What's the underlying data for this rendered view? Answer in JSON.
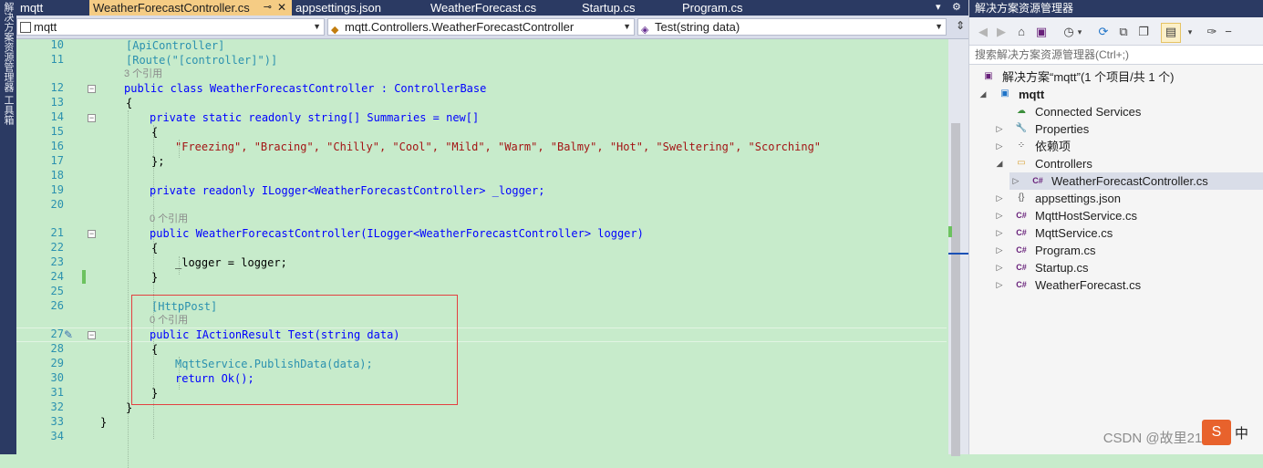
{
  "left_strip": {
    "items": [
      "解决方案资源管理器",
      "工具箱"
    ]
  },
  "tabs": [
    {
      "label": "mqtt",
      "active": false
    },
    {
      "label": "WeatherForecastController.cs",
      "active": true,
      "pin": "⊸",
      "close": "✕"
    },
    {
      "label": "appsettings.json",
      "active": false
    },
    {
      "label": "WeatherForecast.cs",
      "active": false
    },
    {
      "label": "Startup.cs",
      "active": false
    },
    {
      "label": "Program.cs",
      "active": false
    }
  ],
  "tabbar_controls": {
    "dropdown": "▾",
    "settings": "⚙"
  },
  "navbar": {
    "project": "mqtt",
    "type": "mqtt.Controllers.WeatherForecastController",
    "member": "Test(string data)"
  },
  "editor": {
    "codelens": {
      "refs3": "3 个引用",
      "refs0": "0 个引用"
    },
    "lines": {
      "10": "[ApiController]",
      "11": "[Route(\"[controller]\")]",
      "12": "public class WeatherForecastController : ControllerBase",
      "13": "{",
      "14": "private static readonly string[] Summaries = new[]",
      "15": "{",
      "16": "\"Freezing\", \"Bracing\", \"Chilly\", \"Cool\", \"Mild\", \"Warm\", \"Balmy\", \"Hot\", \"Sweltering\", \"Scorching\"",
      "17": "};",
      "18": "",
      "19": "private readonly ILogger<WeatherForecastController> _logger;",
      "20": "",
      "21": "public WeatherForecastController(ILogger<WeatherForecastController> logger)",
      "22": "{",
      "23": "_logger = logger;",
      "24": "}",
      "25": "",
      "26": "[HttpPost]",
      "27": "public IActionResult Test(string data)",
      "28": "{",
      "29": "MqttService.PublishData(data);",
      "30": "return Ok();",
      "31": "}",
      "32": "}",
      "33": "}",
      "34": ""
    },
    "line_numbers": [
      "10",
      "11",
      "12",
      "13",
      "14",
      "15",
      "16",
      "17",
      "18",
      "19",
      "20",
      "21",
      "22",
      "23",
      "24",
      "25",
      "26",
      "27",
      "28",
      "29",
      "30",
      "31",
      "32",
      "33",
      "34"
    ]
  },
  "solution_explorer": {
    "title": "解决方案资源管理器",
    "search_placeholder": "搜索解决方案资源管理器(Ctrl+;)",
    "tree": {
      "solution": "解决方案“mqtt”(1 个项目/共 1 个)",
      "project": "mqtt",
      "connected": "Connected Services",
      "properties": "Properties",
      "deps": "依赖项",
      "controllers": "Controllers",
      "controller_file": "WeatherForecastController.cs",
      "appsettings": "appsettings.json",
      "hostservice": "MqttHostService.cs",
      "mqttservice": "MqttService.cs",
      "program": "Program.cs",
      "startup": "Startup.cs",
      "weatherforecast": "WeatherForecast.cs"
    }
  },
  "watermark": "CSDN @故里2130",
  "ime": {
    "logo": "S",
    "mode": "中"
  },
  "colors": {
    "editor_bg": "#c7ebcb",
    "accent": "#2b3a63",
    "active_tab": "#f5cc84",
    "highlight_box": "#e34040"
  }
}
